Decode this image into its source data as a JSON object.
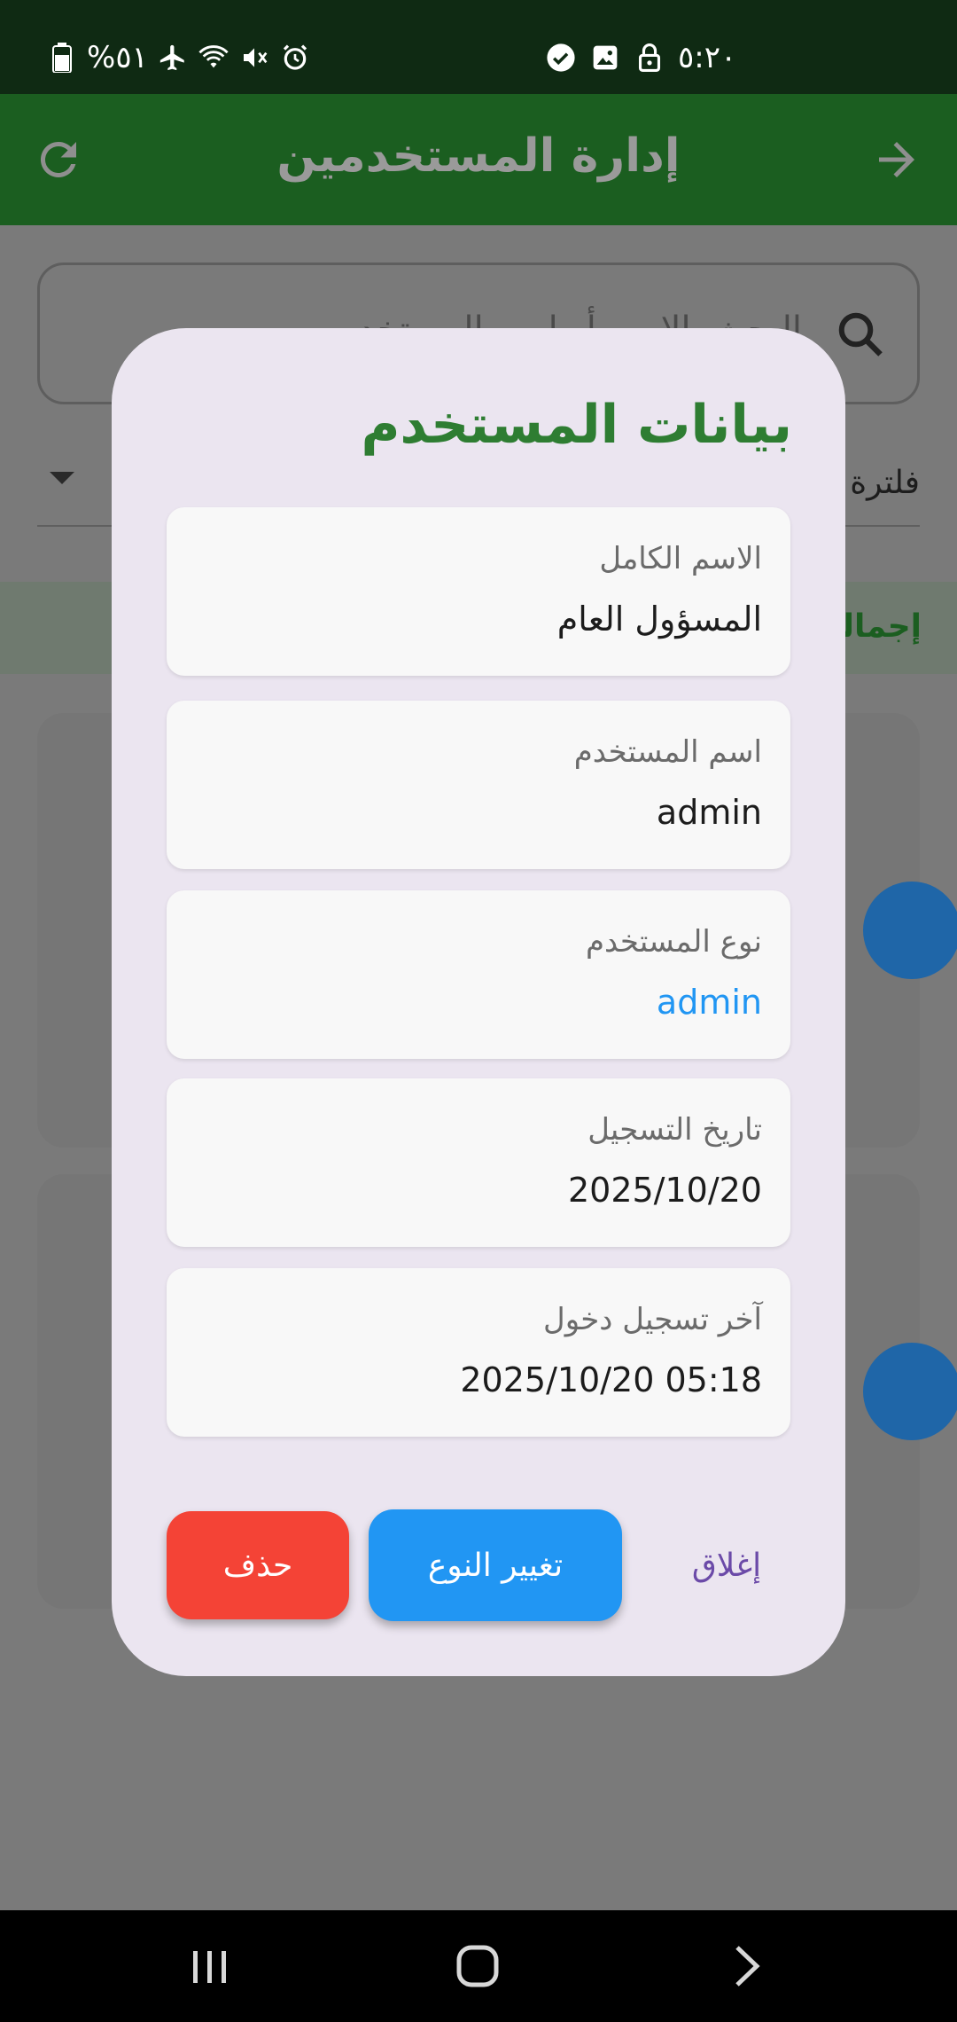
{
  "status_bar": {
    "battery_text": "%٥١",
    "time": "٥:٢٠",
    "icons": [
      "battery-icon",
      "airplane-icon",
      "wifi-icon",
      "mute-icon",
      "alarm-icon",
      "check-circle-icon",
      "image-icon",
      "lock-icon"
    ]
  },
  "app_bar": {
    "title": "إدارة المستخدمين",
    "back_icon": "arrow-forward-icon",
    "refresh_icon": "refresh-icon"
  },
  "search": {
    "placeholder": "البحث بالاسم أو اسم المستخدم"
  },
  "filter": {
    "label": "فلترة"
  },
  "totals": {
    "label": "إجمالي"
  },
  "dialog": {
    "title": "بيانات المستخدم",
    "fields": [
      {
        "label": "الاسم الكامل",
        "value": "المسؤول العام"
      },
      {
        "label": "اسم المستخدم",
        "value": "admin"
      },
      {
        "label": "نوع المستخدم",
        "value": "admin"
      },
      {
        "label": "تاريخ التسجيل",
        "value": "2025/10/20"
      },
      {
        "label": "آخر تسجيل دخول",
        "value": "05:18 2025/10/20"
      }
    ],
    "buttons": {
      "delete": "حذف",
      "change_type": "تغيير النوع",
      "close": "إغلاق"
    }
  },
  "colors": {
    "primary_green": "#2e7d32",
    "accent_blue": "#2196f3",
    "danger_red": "#f44336",
    "dialog_bg": "#ebe5f0"
  }
}
